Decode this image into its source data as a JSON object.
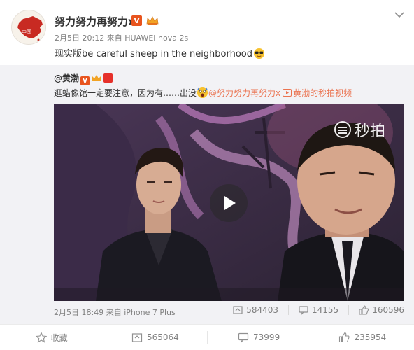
{
  "post": {
    "username": "努力努力再努力x",
    "v_badge": "V",
    "date": "2月5日 20:12",
    "source_prefix": "来自",
    "device": "HUAWEI nova 2s",
    "text": "现实版be careful sheep in the neighborhood",
    "avatar_text": "中国"
  },
  "repost": {
    "username": "@黄渤",
    "v_badge": "V",
    "text_main": "逛蜡像馆一定要注意，因为有……出没",
    "mention": "@努力努力再努力x",
    "video_link": "黄渤的秒拍视频",
    "watermark": "秒拍",
    "time": "2月5日 18:49",
    "source_prefix": "来自",
    "device": "iPhone 7 Plus",
    "reposts": "584403",
    "comments": "14155",
    "likes": "160596"
  },
  "actions": {
    "favorite": "收藏",
    "repost": "565064",
    "comment": "73999",
    "like": "235954"
  },
  "colors": {
    "accent": "#eb7350",
    "verified_badge": "#e8541e",
    "repost_bg": "#f2f2f5",
    "meta_text": "#808080"
  },
  "icons": [
    "more-icon",
    "crown-icon",
    "sunglasses-emoji-icon",
    "shocked-emoji-icon",
    "video-icon",
    "play-icon",
    "miaopai-logo-icon",
    "repost-icon",
    "comment-icon",
    "like-icon",
    "star-icon"
  ]
}
